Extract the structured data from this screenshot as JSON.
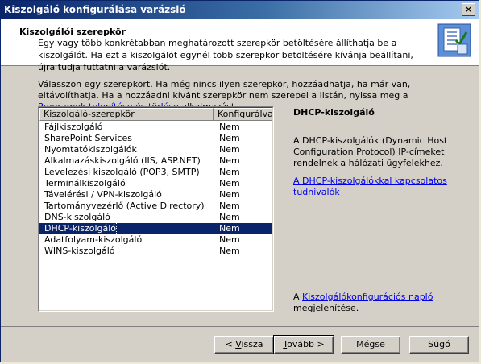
{
  "window": {
    "title": "Kiszolgáló konfigurálása varázsló",
    "close_glyph": "×"
  },
  "header": {
    "title": "Kiszolgálói szerepkör",
    "description": "Egy vagy több konkrétabban meghatározott szerepkör betöltésére állíthatja be a kiszolgálót. Ha ezt a kiszolgálót egynél több szerepkör betöltésére kívánja beállítani, újra tudja futtatni a varázslót.",
    "icon": "wizard-checklist-icon"
  },
  "intro": {
    "text_before": "Válasszon egy szerepkört. Ha még nincs ilyen szerepkör, hozzáadhatja, ha már van, eltávolíthatja. Ha a hozzáadni kívánt szerepkör nem szerepel a listán, nyissa meg a ",
    "link": "Programok telepítése és törlése",
    "text_after": " alkalmazást."
  },
  "table": {
    "headers": [
      "Kiszolgáló-szerepkör",
      "Konfigurálva"
    ],
    "rows": [
      {
        "role": "Fájlkiszolgáló",
        "configured": "Nem"
      },
      {
        "role": "SharePoint Services",
        "configured": "Nem"
      },
      {
        "role": "Nyomtatókiszolgálók",
        "configured": "Nem"
      },
      {
        "role": "Alkalmazáskiszolgáló (IIS, ASP.NET)",
        "configured": "Nem"
      },
      {
        "role": "Levelezési kiszolgáló (POP3, SMTP)",
        "configured": "Nem"
      },
      {
        "role": "Terminálkiszolgáló",
        "configured": "Nem"
      },
      {
        "role": "Távelérési / VPN-kiszolgáló",
        "configured": "Nem"
      },
      {
        "role": "Tartományvezérlő (Active Directory)",
        "configured": "Nem"
      },
      {
        "role": "DNS-kiszolgáló",
        "configured": "Nem"
      },
      {
        "role": "DHCP-kiszolgáló",
        "configured": "Nem",
        "selected": true
      },
      {
        "role": "Adatfolyam-kiszolgáló",
        "configured": "Nem"
      },
      {
        "role": "WINS-kiszolgáló",
        "configured": "Nem"
      }
    ]
  },
  "detail": {
    "title": "DHCP-kiszolgáló",
    "description": "A DHCP-kiszolgálók (Dynamic Host Configuration Protocol) IP-címeket rendelnek a hálózati ügyfelekhez.",
    "link": "A DHCP-kiszolgálókkal kapcsolatos tudnivalók"
  },
  "log": {
    "prefix": "A ",
    "link": "Kiszolgálókonfigurációs napló",
    "suffix": " megjelenítése."
  },
  "buttons": {
    "back": {
      "pre": "< ",
      "u": "V",
      "post": "issza"
    },
    "next": {
      "u": "T",
      "post": "ovább >"
    },
    "cancel": "Mégse",
    "help": "Súgó"
  }
}
